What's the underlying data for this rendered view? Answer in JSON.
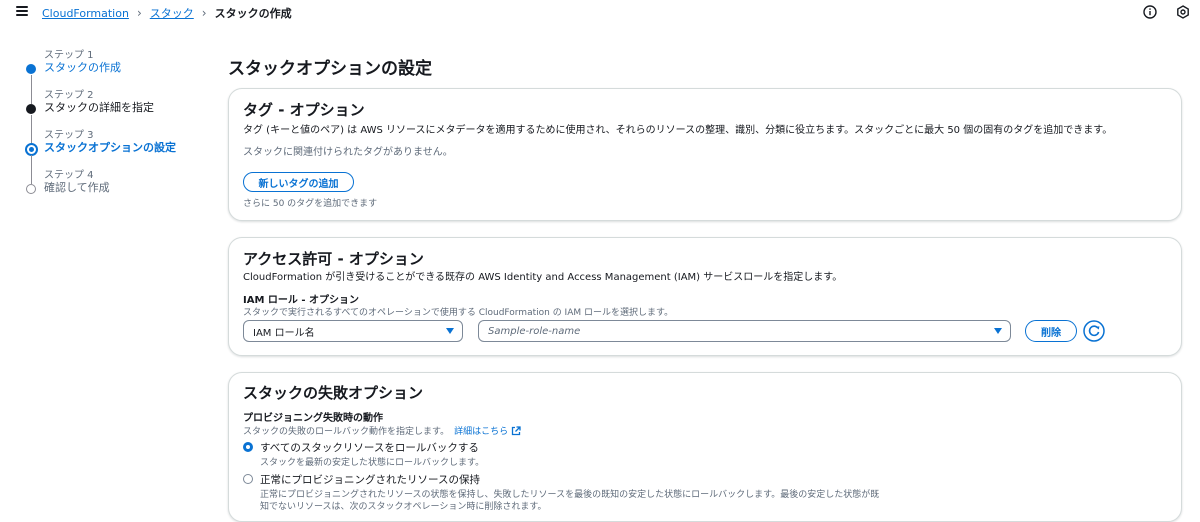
{
  "breadcrumb": {
    "items": [
      "CloudFormation",
      "スタック"
    ],
    "current": "スタックの作成"
  },
  "steps": [
    {
      "num": "ステップ 1",
      "label": "スタックの作成"
    },
    {
      "num": "ステップ 2",
      "label": "スタックの詳細を指定"
    },
    {
      "num": "ステップ 3",
      "label": "スタックオプションの設定"
    },
    {
      "num": "ステップ 4",
      "label": "確認して作成"
    }
  ],
  "page": {
    "title": "スタックオプションの設定"
  },
  "tags": {
    "title": "タグ - オプション",
    "description": "タグ (キーと値のペア) は AWS リソースにメタデータを適用するために使用され、それらのリソースの整理、識別、分類に役立ちます。スタックごとに最大 50 個の固有のタグを追加できます。",
    "empty": "スタックに関連付けられたタグがありません。",
    "add_button": "新しいタグの追加",
    "hint": "さらに 50 のタグを追加できます"
  },
  "permissions": {
    "title": "アクセス許可 - オプション",
    "description": "CloudFormation が引き受けることができる既存の AWS Identity and Access Management (IAM) サービスロールを指定します。",
    "role_label": "IAM ロール - オプション",
    "role_desc": "スタックで実行されるすべてのオペレーションで使用する CloudFormation の IAM ロールを選択します。",
    "select_value": "IAM ロール名",
    "role_placeholder": "Sample-role-name",
    "delete_button": "削除"
  },
  "failure": {
    "title": "スタックの失敗オプション",
    "behavior_label": "プロビジョニング失敗時の動作",
    "behavior_desc": "スタックの失敗のロールバック動作を指定します。",
    "learn_more": "詳細はこちら",
    "options": [
      {
        "label": "すべてのスタックリソースをロールバックする",
        "desc": "スタックを最新の安定した状態にロールバックします。",
        "selected": true
      },
      {
        "label": "正常にプロビジョニングされたリソースの保持",
        "desc": "正常にプロビジョニングされたリソースの状態を保持し、失敗したリソースを最後の既知の安定した状態にロールバックします。最後の安定した状態が既",
        "desc2": "知でないリソースは、次のスタックオペレーション時に削除されます。",
        "selected": false
      }
    ]
  },
  "colors": {
    "accent": "#0972d3",
    "text": "#16191f",
    "muted": "#5f6b7a",
    "border": "#d5dbdb"
  },
  "icons": [
    "menu-icon",
    "info-icon",
    "settings-icon",
    "external-link-icon",
    "refresh-icon",
    "chevron-right-icon",
    "caret-down-icon"
  ]
}
